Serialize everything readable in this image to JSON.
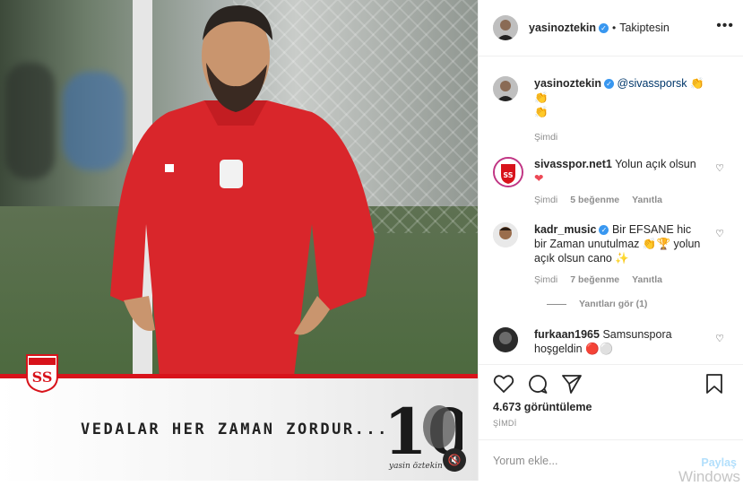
{
  "media": {
    "slogan": "VEDALAR HER ZAMAN ZORDUR...",
    "number": "10",
    "signature": "yasin öztekin",
    "mute_icon": "speaker-muted-icon"
  },
  "header": {
    "username": "yasinoztekin",
    "follow_label": "Takiptesin",
    "separator": "•",
    "more_icon": "ellipsis-icon"
  },
  "caption": {
    "username": "yasinoztekin",
    "mention": "@sivassporsk",
    "emoji": "👏👏\n👏",
    "time": "Şimdi"
  },
  "comments": [
    {
      "username": "sivasspor.net1",
      "text": "Yolun açık olsun",
      "emoji": "❤",
      "time": "Şimdi",
      "likes": "5 beğenme",
      "reply": "Yanıtla"
    },
    {
      "username": "kadr_music",
      "text": "Bir EFSANE hic bir Zaman unutulmaz 👏🏆 yolun açık olsun cano ✨",
      "time": "Şimdi",
      "likes": "7 beğenme",
      "reply": "Yanıtla",
      "view_replies": "Yanıtları gör (1)"
    },
    {
      "username": "furkaan1965",
      "text": "Samsunspora hoşgeldin",
      "emoji": "🔴⚪"
    }
  ],
  "actions": {
    "views": "4.673 görüntüleme",
    "time": "ŞİMDİ"
  },
  "add_comment": {
    "placeholder": "Yorum ekle...",
    "share": "Paylaş",
    "watermark": "Windows"
  },
  "colors": {
    "accent": "#3897f0",
    "brand_red": "#d8131b"
  }
}
